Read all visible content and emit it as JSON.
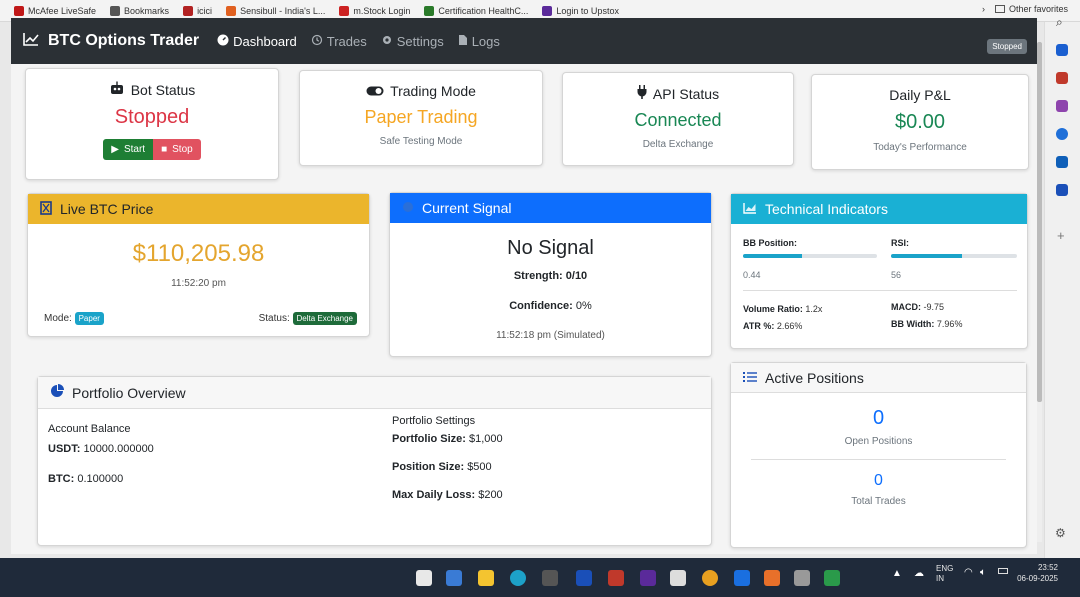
{
  "browser": {
    "bookmarks": [
      {
        "label": "McAfee LiveSafe",
        "color": "#c01818"
      },
      {
        "label": "Bookmarks",
        "color": "#555555"
      },
      {
        "label": "icici",
        "color": "#b22222"
      },
      {
        "label": "Sensibull - India's L...",
        "color": "#e06020"
      },
      {
        "label": "m.Stock Login",
        "color": "#cc2222"
      },
      {
        "label": "Certification HealthC...",
        "color": "#2a7a2a"
      },
      {
        "label": "Login to Upstox",
        "color": "#5a2a9a"
      }
    ],
    "other_favorites": "Other favorites"
  },
  "nav": {
    "brand": "BTC Options Trader",
    "links": [
      {
        "label": "Dashboard",
        "active": true
      },
      {
        "label": "Trades",
        "active": false
      },
      {
        "label": "Settings",
        "active": false
      },
      {
        "label": "Logs",
        "active": false
      }
    ],
    "status_badge": "Stopped"
  },
  "stats": {
    "bot": {
      "title": "Bot Status",
      "value": "Stopped",
      "start_label": "Start",
      "stop_label": "Stop"
    },
    "mode": {
      "title": "Trading Mode",
      "value": "Paper Trading",
      "sub": "Safe Testing Mode"
    },
    "api": {
      "title": "API Status",
      "value": "Connected",
      "sub": "Delta Exchange"
    },
    "pnl": {
      "title": "Daily P&L",
      "value": "$0.00",
      "sub": "Today's Performance"
    }
  },
  "price": {
    "header": "Live BTC Price",
    "value": "$110,205.98",
    "time": "11:52:20 pm",
    "mode_label": "Mode:",
    "mode_badge": "Paper",
    "status_label": "Status:",
    "status_badge": "Delta Exchange"
  },
  "signal": {
    "header": "Current Signal",
    "value": "No Signal",
    "strength_label": "Strength:",
    "strength": "0/10",
    "confidence_label": "Confidence:",
    "confidence": "0%",
    "time": "11:52:18 pm (Simulated)"
  },
  "indicators": {
    "header": "Technical Indicators",
    "bb_label": "BB Position:",
    "bb_value": "0.44",
    "bb_fraction": 0.44,
    "rsi_label": "RSI:",
    "rsi_value": "56",
    "rsi_fraction": 0.56,
    "volume_label": "Volume Ratio:",
    "volume": "1.2x",
    "macd_label": "MACD:",
    "macd": "-9.75",
    "atr_label": "ATR %:",
    "atr": "2.66%",
    "bbw_label": "BB Width:",
    "bbw": "7.96%"
  },
  "portfolio": {
    "header": "Portfolio Overview",
    "balance_title": "Account Balance",
    "usdt_label": "USDT:",
    "usdt": "10000.000000",
    "btc_label": "BTC:",
    "btc": "0.100000",
    "settings_title": "Portfolio Settings",
    "size_label": "Portfolio Size:",
    "size": "$1,000",
    "position_label": "Position Size:",
    "position": "$500",
    "loss_label": "Max Daily Loss:",
    "loss": "$200"
  },
  "positions": {
    "header": "Active Positions",
    "open_count": "0",
    "open_label": "Open Positions",
    "total_count": "0",
    "total_label": "Total Trades"
  },
  "taskbar": {
    "lang_top": "ENG",
    "lang_bottom": "IN",
    "time": "23:52",
    "date": "06-09-2025"
  }
}
